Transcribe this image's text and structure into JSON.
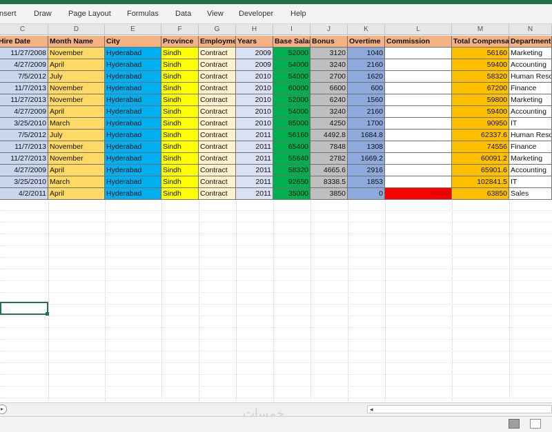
{
  "ribbon": {
    "tabs": [
      "Insert",
      "Draw",
      "Page Layout",
      "Formulas",
      "Data",
      "View",
      "Developer",
      "Help"
    ]
  },
  "columns": {
    "letters": [
      "C",
      "D",
      "E",
      "F",
      "G",
      "H",
      "I",
      "J",
      "K",
      "L",
      "M",
      "N"
    ]
  },
  "table": {
    "headers": [
      "Hire Date",
      "Month Name",
      "City",
      "Province",
      "Employment",
      "Years",
      "Base Salary",
      "Bonus",
      "Overtime",
      "Commission",
      "Total Compensation",
      "Department"
    ],
    "rows": [
      [
        "11/27/2008",
        "November",
        "Hyderabad",
        "Sindh",
        "Contract",
        "2009",
        "52000",
        "3120",
        "1040",
        "",
        "56160",
        "Marketing"
      ],
      [
        "4/27/2009",
        "April",
        "Hyderabad",
        "Sindh",
        "Contract",
        "2009",
        "54000",
        "3240",
        "2160",
        "",
        "59400",
        "Accounting"
      ],
      [
        "7/5/2012",
        "July",
        "Hyderabad",
        "Sindh",
        "Contract",
        "2010",
        "54000",
        "2700",
        "1620",
        "",
        "58320",
        "Human Resources"
      ],
      [
        "11/7/2013",
        "November",
        "Hyderabad",
        "Sindh",
        "Contract",
        "2010",
        "60000",
        "6600",
        "600",
        "",
        "67200",
        "Finance"
      ],
      [
        "11/27/2013",
        "November",
        "Hyderabad",
        "Sindh",
        "Contract",
        "2010",
        "52000",
        "6240",
        "1560",
        "",
        "59800",
        "Marketing"
      ],
      [
        "4/27/2009",
        "April",
        "Hyderabad",
        "Sindh",
        "Contract",
        "2010",
        "54000",
        "3240",
        "2160",
        "",
        "59400",
        "Accounting"
      ],
      [
        "3/25/2010",
        "March",
        "Hyderabad",
        "Sindh",
        "Contract",
        "2010",
        "85000",
        "4250",
        "1700",
        "",
        "90950",
        "IT"
      ],
      [
        "7/5/2012",
        "July",
        "Hyderabad",
        "Sindh",
        "Contract",
        "2011",
        "56160",
        "4492.8",
        "1684.8",
        "",
        "62337.6",
        "Human Resources"
      ],
      [
        "11/7/2013",
        "November",
        "Hyderabad",
        "Sindh",
        "Contract",
        "2011",
        "65400",
        "7848",
        "1308",
        "",
        "74556",
        "Finance"
      ],
      [
        "11/27/2013",
        "November",
        "Hyderabad",
        "Sindh",
        "Contract",
        "2011",
        "55640",
        "2782",
        "1669.2",
        "",
        "60091.2",
        "Marketing"
      ],
      [
        "4/27/2009",
        "April",
        "Hyderabad",
        "Sindh",
        "Contract",
        "2011",
        "58320",
        "4665.6",
        "2916",
        "",
        "65901.6",
        "Accounting"
      ],
      [
        "3/25/2010",
        "March",
        "Hyderabad",
        "Sindh",
        "Contract",
        "2011",
        "92650",
        "8338.5",
        "1853",
        "",
        "102841.5",
        "IT"
      ],
      [
        "4/2/2011",
        "April",
        "Hyderabad",
        "Sindh",
        "Contract",
        "2011",
        "35000",
        "3850",
        "0",
        "25000",
        "63850",
        "Sales"
      ]
    ]
  },
  "colors": {
    "accent": "#217346",
    "header": "#f4b183",
    "hire_date": "#c9d6ee",
    "month": "#ffd966",
    "city": "#00b0f0",
    "province": "#ffff00",
    "employment": "#fff2cc",
    "years": "#d9e1f2",
    "base_salary": "#00b050",
    "bonus": "#bfbfbf",
    "overtime": "#8ea9db",
    "commission": "#ffffff",
    "commission_highlight": "#ff0000",
    "total": "#ffc000",
    "department": "#ffffff"
  },
  "watermark": "خمسات",
  "view_icons": [
    "normal-view-icon",
    "page-layout-view-icon"
  ]
}
